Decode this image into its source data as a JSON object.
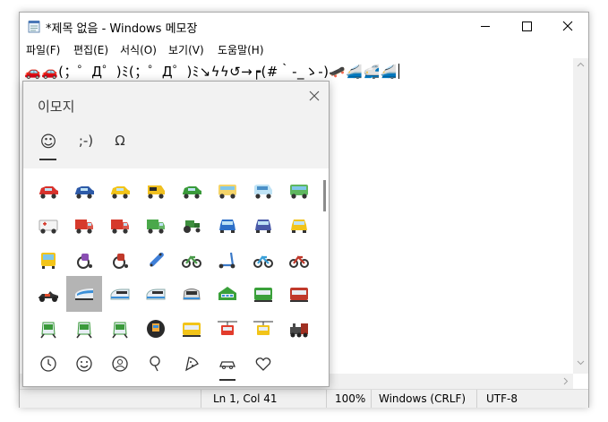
{
  "window": {
    "title": "*제목 없음 - Windows 메모장",
    "controls": [
      "minimize",
      "maximize",
      "close"
    ]
  },
  "menu": [
    "파일(F)",
    "편집(E)",
    "서식(O)",
    "보기(V)",
    "도움말(H)"
  ],
  "editor": {
    "text": "🚗🚗(；゜Д゜)ﾐ(；゜Д゜)ﾐ↘ϟϟ↺→┍(#｀-_ゝ-)🛹🚄🚅🚄"
  },
  "emoji_picker": {
    "title": "이모지",
    "tabs": [
      {
        "label": "☺",
        "name": "emoji",
        "selected": true
      },
      {
        "label": ";-)",
        "name": "kaomoji",
        "selected": false
      },
      {
        "label": "Ω",
        "name": "symbols",
        "selected": false
      }
    ],
    "grid": [
      [
        "car-red",
        "police-car",
        "taxi",
        "auto-rickshaw",
        "suv",
        "trolleybus",
        "minibus",
        "tram"
      ],
      [
        "ambulance",
        "fire-engine",
        "delivery-truck",
        "lorry",
        "tractor",
        "car-front",
        "police-car-front",
        "taxi-front"
      ],
      [
        "bus-front",
        "manual-wheelchair",
        "motorized-wheelchair",
        "skateboard",
        "bicycle",
        "kick-scooter",
        "motor-scooter",
        "motorcycle"
      ],
      [
        "racing-car",
        "high-speed-train",
        "bullet-train",
        "train",
        "locomotive-front",
        "station",
        "railway-car",
        "tram-car"
      ],
      [
        "metro",
        "light-rail",
        "monorail",
        "train-front",
        "mountain-railway",
        "mountain-cableway",
        "aerial-tramway",
        "steam-locomotive"
      ]
    ],
    "selected_cell": "high-speed-train",
    "categories": [
      "clock-icon",
      "smiley-icon",
      "person-icon",
      "pin-icon",
      "pizza-icon",
      "car-icon",
      "heart-icon"
    ],
    "active_category": "car-icon"
  },
  "status": {
    "position": "Ln 1, Col 41",
    "zoom": "100%",
    "line_ending": "Windows (CRLF)",
    "encoding": "UTF-8"
  }
}
